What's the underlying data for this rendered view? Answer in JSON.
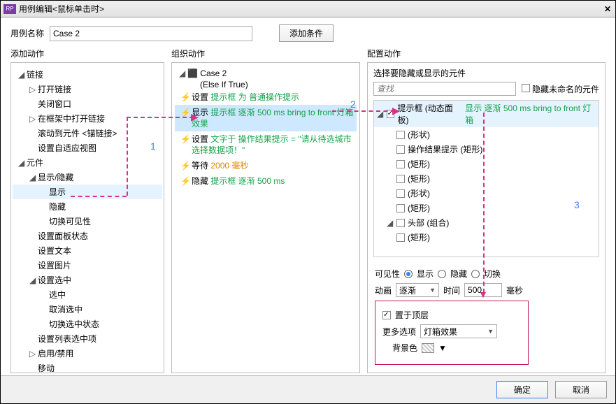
{
  "title": "用例编辑<鼠标单击时>",
  "case_name_label": "用例名称",
  "case_name_value": "Case 2",
  "add_condition": "添加条件",
  "headers": {
    "c1": "添加动作",
    "c2": "组织动作",
    "c3": "配置动作"
  },
  "tree": {
    "links": "链接",
    "open_link": "打开链接",
    "close_window": "关闭窗口",
    "open_in_frame": "在框架中打开链接",
    "scroll_to": "滚动到元件 <锚链接>",
    "set_adaptive": "设置自适应视图",
    "widgets": "元件",
    "show_hide": "显示/隐藏",
    "show": "显示",
    "hide": "隐藏",
    "toggle_vis": "切换可见性",
    "panel_state": "设置面板状态",
    "set_text": "设置文本",
    "set_image": "设置图片",
    "set_selected": "设置选中",
    "selected": "选中",
    "unselect": "取消选中",
    "toggle_sel": "切换选中状态",
    "set_list": "设置列表选中项",
    "enable_disable": "启用/禁用",
    "move": "移动"
  },
  "org": {
    "case": "Case 2",
    "else": "(Else If True)",
    "a1_pre": "设置 ",
    "a1_g1": "提示框 为 普通操作提示",
    "a2_pre": "显示 ",
    "a2_g1": "提示框 逐渐 500 ms bring to front",
    "a2_g2": " 灯箱效果",
    "a3_pre": "设置 ",
    "a3_g1": "文字于 操作结果提示 = \"请从待选城市选择数据项！\"",
    "a4_pre": "等待 ",
    "a4_o": "2000 毫秒",
    "a5_pre": "隐藏 ",
    "a5_g": "提示框 逐渐 500 ms"
  },
  "cfg": {
    "title": "选择要隐藏或显示的元件",
    "search_ph": "查找",
    "hide_unnamed": "隐藏未命名的元件",
    "w1a": "提示框 (动态面板) ",
    "w1b": "显示 逐渐 500 ms bring to front 灯箱",
    "w2": "(形状)",
    "w3": "操作结果提示 (矩形)",
    "w4": "(矩形)",
    "w5": "(矩形)",
    "w6": "(形状)",
    "w7": "(矩形)",
    "w8": "头部 (组合)",
    "w9": "(矩形)",
    "vis_label": "可见性",
    "r_show": "显示",
    "r_hide": "隐藏",
    "r_toggle": "切换",
    "anim_label": "动画",
    "anim_val": "逐渐",
    "time_label": "时间",
    "time_val": "500",
    "ms": "毫秒",
    "bring_front": "置于顶层",
    "more_opts": "更多选项",
    "more_val": "灯箱效果",
    "bg_color": "背景色"
  },
  "ok": "确定",
  "cancel": "取消",
  "anno": {
    "n1": "1",
    "n2": "2",
    "n3": "3"
  }
}
